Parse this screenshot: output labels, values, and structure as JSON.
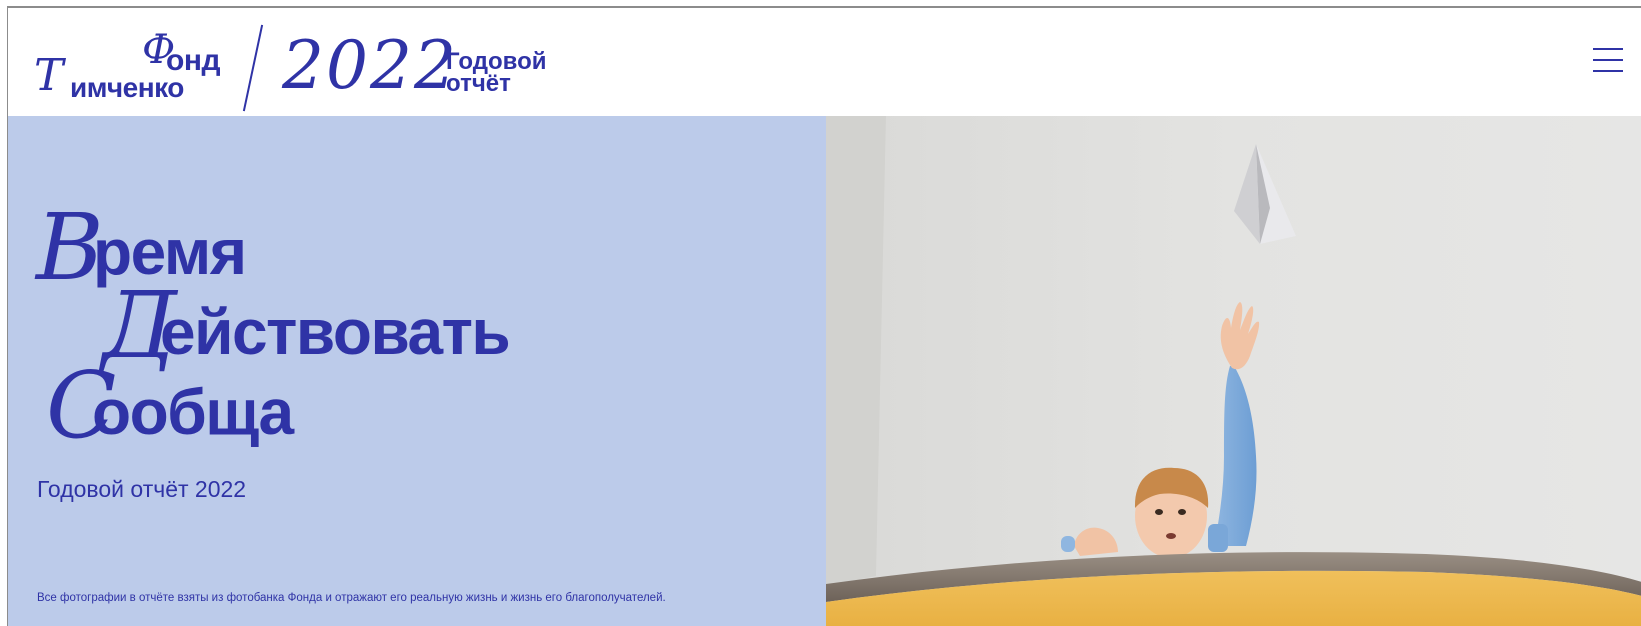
{
  "header": {
    "logo": {
      "fond_initial": "Ф",
      "fond_rest": "онд",
      "tim_initial": "Т",
      "tim_rest": "имченко",
      "year": "2022",
      "report_line1": "Годовой",
      "report_line2": "отчёт"
    },
    "menu_icon": "hamburger-icon"
  },
  "hero": {
    "headline": [
      {
        "initial": "В",
        "rest": "ремя"
      },
      {
        "initial": "Д",
        "rest": "ействовать"
      },
      {
        "initial": "С",
        "rest": "ообща"
      }
    ],
    "subtitle": "Годовой отчёт 2022",
    "disclaimer": "Все фотографии в отчёте взяты из фотобанка Фонда и отражают его реальную жизнь и жизнь его благополучателей."
  },
  "colors": {
    "brand": "#2f33a6",
    "hero_left_bg": "#bccbea",
    "hero_right_bg": "#dfdfde"
  }
}
